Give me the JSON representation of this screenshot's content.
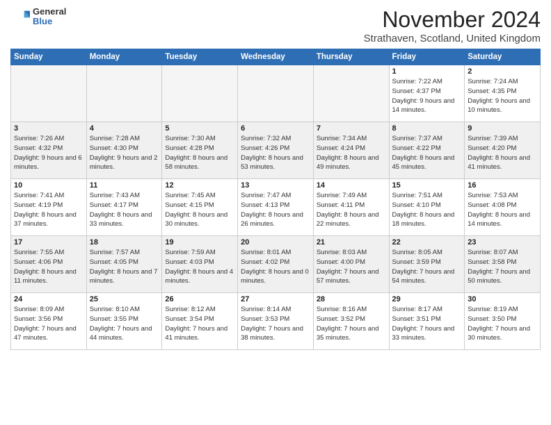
{
  "header": {
    "logo": {
      "general": "General",
      "blue": "Blue"
    },
    "title": "November 2024",
    "subtitle": "Strathaven, Scotland, United Kingdom"
  },
  "calendar": {
    "headers": [
      "Sunday",
      "Monday",
      "Tuesday",
      "Wednesday",
      "Thursday",
      "Friday",
      "Saturday"
    ],
    "weeks": [
      [
        {
          "day": "",
          "info": ""
        },
        {
          "day": "",
          "info": ""
        },
        {
          "day": "",
          "info": ""
        },
        {
          "day": "",
          "info": ""
        },
        {
          "day": "",
          "info": ""
        },
        {
          "day": "1",
          "info": "Sunrise: 7:22 AM\nSunset: 4:37 PM\nDaylight: 9 hours and 14 minutes."
        },
        {
          "day": "2",
          "info": "Sunrise: 7:24 AM\nSunset: 4:35 PM\nDaylight: 9 hours and 10 minutes."
        }
      ],
      [
        {
          "day": "3",
          "info": "Sunrise: 7:26 AM\nSunset: 4:32 PM\nDaylight: 9 hours and 6 minutes."
        },
        {
          "day": "4",
          "info": "Sunrise: 7:28 AM\nSunset: 4:30 PM\nDaylight: 9 hours and 2 minutes."
        },
        {
          "day": "5",
          "info": "Sunrise: 7:30 AM\nSunset: 4:28 PM\nDaylight: 8 hours and 58 minutes."
        },
        {
          "day": "6",
          "info": "Sunrise: 7:32 AM\nSunset: 4:26 PM\nDaylight: 8 hours and 53 minutes."
        },
        {
          "day": "7",
          "info": "Sunrise: 7:34 AM\nSunset: 4:24 PM\nDaylight: 8 hours and 49 minutes."
        },
        {
          "day": "8",
          "info": "Sunrise: 7:37 AM\nSunset: 4:22 PM\nDaylight: 8 hours and 45 minutes."
        },
        {
          "day": "9",
          "info": "Sunrise: 7:39 AM\nSunset: 4:20 PM\nDaylight: 8 hours and 41 minutes."
        }
      ],
      [
        {
          "day": "10",
          "info": "Sunrise: 7:41 AM\nSunset: 4:19 PM\nDaylight: 8 hours and 37 minutes."
        },
        {
          "day": "11",
          "info": "Sunrise: 7:43 AM\nSunset: 4:17 PM\nDaylight: 8 hours and 33 minutes."
        },
        {
          "day": "12",
          "info": "Sunrise: 7:45 AM\nSunset: 4:15 PM\nDaylight: 8 hours and 30 minutes."
        },
        {
          "day": "13",
          "info": "Sunrise: 7:47 AM\nSunset: 4:13 PM\nDaylight: 8 hours and 26 minutes."
        },
        {
          "day": "14",
          "info": "Sunrise: 7:49 AM\nSunset: 4:11 PM\nDaylight: 8 hours and 22 minutes."
        },
        {
          "day": "15",
          "info": "Sunrise: 7:51 AM\nSunset: 4:10 PM\nDaylight: 8 hours and 18 minutes."
        },
        {
          "day": "16",
          "info": "Sunrise: 7:53 AM\nSunset: 4:08 PM\nDaylight: 8 hours and 14 minutes."
        }
      ],
      [
        {
          "day": "17",
          "info": "Sunrise: 7:55 AM\nSunset: 4:06 PM\nDaylight: 8 hours and 11 minutes."
        },
        {
          "day": "18",
          "info": "Sunrise: 7:57 AM\nSunset: 4:05 PM\nDaylight: 8 hours and 7 minutes."
        },
        {
          "day": "19",
          "info": "Sunrise: 7:59 AM\nSunset: 4:03 PM\nDaylight: 8 hours and 4 minutes."
        },
        {
          "day": "20",
          "info": "Sunrise: 8:01 AM\nSunset: 4:02 PM\nDaylight: 8 hours and 0 minutes."
        },
        {
          "day": "21",
          "info": "Sunrise: 8:03 AM\nSunset: 4:00 PM\nDaylight: 7 hours and 57 minutes."
        },
        {
          "day": "22",
          "info": "Sunrise: 8:05 AM\nSunset: 3:59 PM\nDaylight: 7 hours and 54 minutes."
        },
        {
          "day": "23",
          "info": "Sunrise: 8:07 AM\nSunset: 3:58 PM\nDaylight: 7 hours and 50 minutes."
        }
      ],
      [
        {
          "day": "24",
          "info": "Sunrise: 8:09 AM\nSunset: 3:56 PM\nDaylight: 7 hours and 47 minutes."
        },
        {
          "day": "25",
          "info": "Sunrise: 8:10 AM\nSunset: 3:55 PM\nDaylight: 7 hours and 44 minutes."
        },
        {
          "day": "26",
          "info": "Sunrise: 8:12 AM\nSunset: 3:54 PM\nDaylight: 7 hours and 41 minutes."
        },
        {
          "day": "27",
          "info": "Sunrise: 8:14 AM\nSunset: 3:53 PM\nDaylight: 7 hours and 38 minutes."
        },
        {
          "day": "28",
          "info": "Sunrise: 8:16 AM\nSunset: 3:52 PM\nDaylight: 7 hours and 35 minutes."
        },
        {
          "day": "29",
          "info": "Sunrise: 8:17 AM\nSunset: 3:51 PM\nDaylight: 7 hours and 33 minutes."
        },
        {
          "day": "30",
          "info": "Sunrise: 8:19 AM\nSunset: 3:50 PM\nDaylight: 7 hours and 30 minutes."
        }
      ]
    ]
  }
}
